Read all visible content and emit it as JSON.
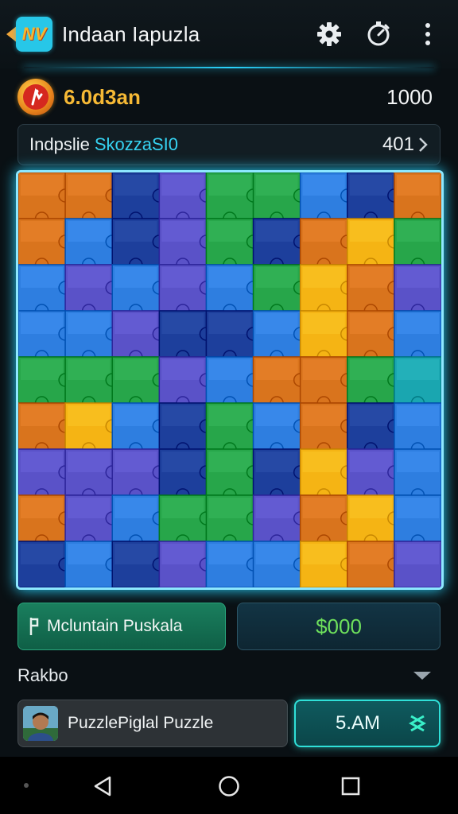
{
  "header": {
    "logo_text": "NV",
    "title": "Indaan Iapuzla",
    "icons": [
      "back-icon",
      "gear-icon",
      "timer-icon",
      "more-icon"
    ]
  },
  "stats": {
    "coin_icon": "coin-icon",
    "coins": "6.0d3an",
    "score": "1000"
  },
  "level": {
    "label": "Indpslie",
    "name": "SkozzaSI0",
    "count": "401"
  },
  "board": {
    "rows": 9,
    "cols": 9,
    "tiles": [
      [
        "orange",
        "orange",
        "navy",
        "purple",
        "green",
        "green",
        "blue",
        "navy",
        "orange"
      ],
      [
        "orange",
        "blue",
        "navy",
        "purple",
        "green",
        "navy",
        "orange",
        "yellow",
        "green"
      ],
      [
        "blue",
        "purple",
        "blue",
        "purple",
        "blue",
        "green",
        "yellow",
        "orange",
        "purple"
      ],
      [
        "blue",
        "blue",
        "purple",
        "navy",
        "navy",
        "blue",
        "yellow",
        "orange",
        "blue"
      ],
      [
        "green",
        "green",
        "green",
        "purple",
        "blue",
        "orange",
        "orange",
        "green",
        "teal"
      ],
      [
        "orange",
        "yellow",
        "blue",
        "navy",
        "green",
        "blue",
        "orange",
        "navy",
        "blue"
      ],
      [
        "purple",
        "purple",
        "purple",
        "navy",
        "green",
        "navy",
        "yellow",
        "purple",
        "blue"
      ],
      [
        "orange",
        "purple",
        "blue",
        "green",
        "green",
        "purple",
        "orange",
        "yellow",
        "blue"
      ],
      [
        "navy",
        "blue",
        "navy",
        "purple",
        "blue",
        "blue",
        "yellow",
        "orange",
        "purple"
      ]
    ],
    "palette": {
      "orange": "#d9741d",
      "yellow": "#f5b414",
      "green": "#27a64a",
      "teal": "#1aa6b0",
      "blue": "#2e7ee0",
      "navy": "#1d3f9c",
      "purple": "#5a52c8"
    }
  },
  "actions": {
    "name_label": "Mcluntain Puskala",
    "price": "$000"
  },
  "section": {
    "title": "Rakbo"
  },
  "player": {
    "name": "PuzzlePiglal Puzzle",
    "time": "5.AM"
  },
  "colors": {
    "accent_cyan": "#2ad4ff",
    "coin_gold": "#f6b935",
    "price_green": "#6ee05c",
    "name_pill_green": "#1a7f5e"
  }
}
